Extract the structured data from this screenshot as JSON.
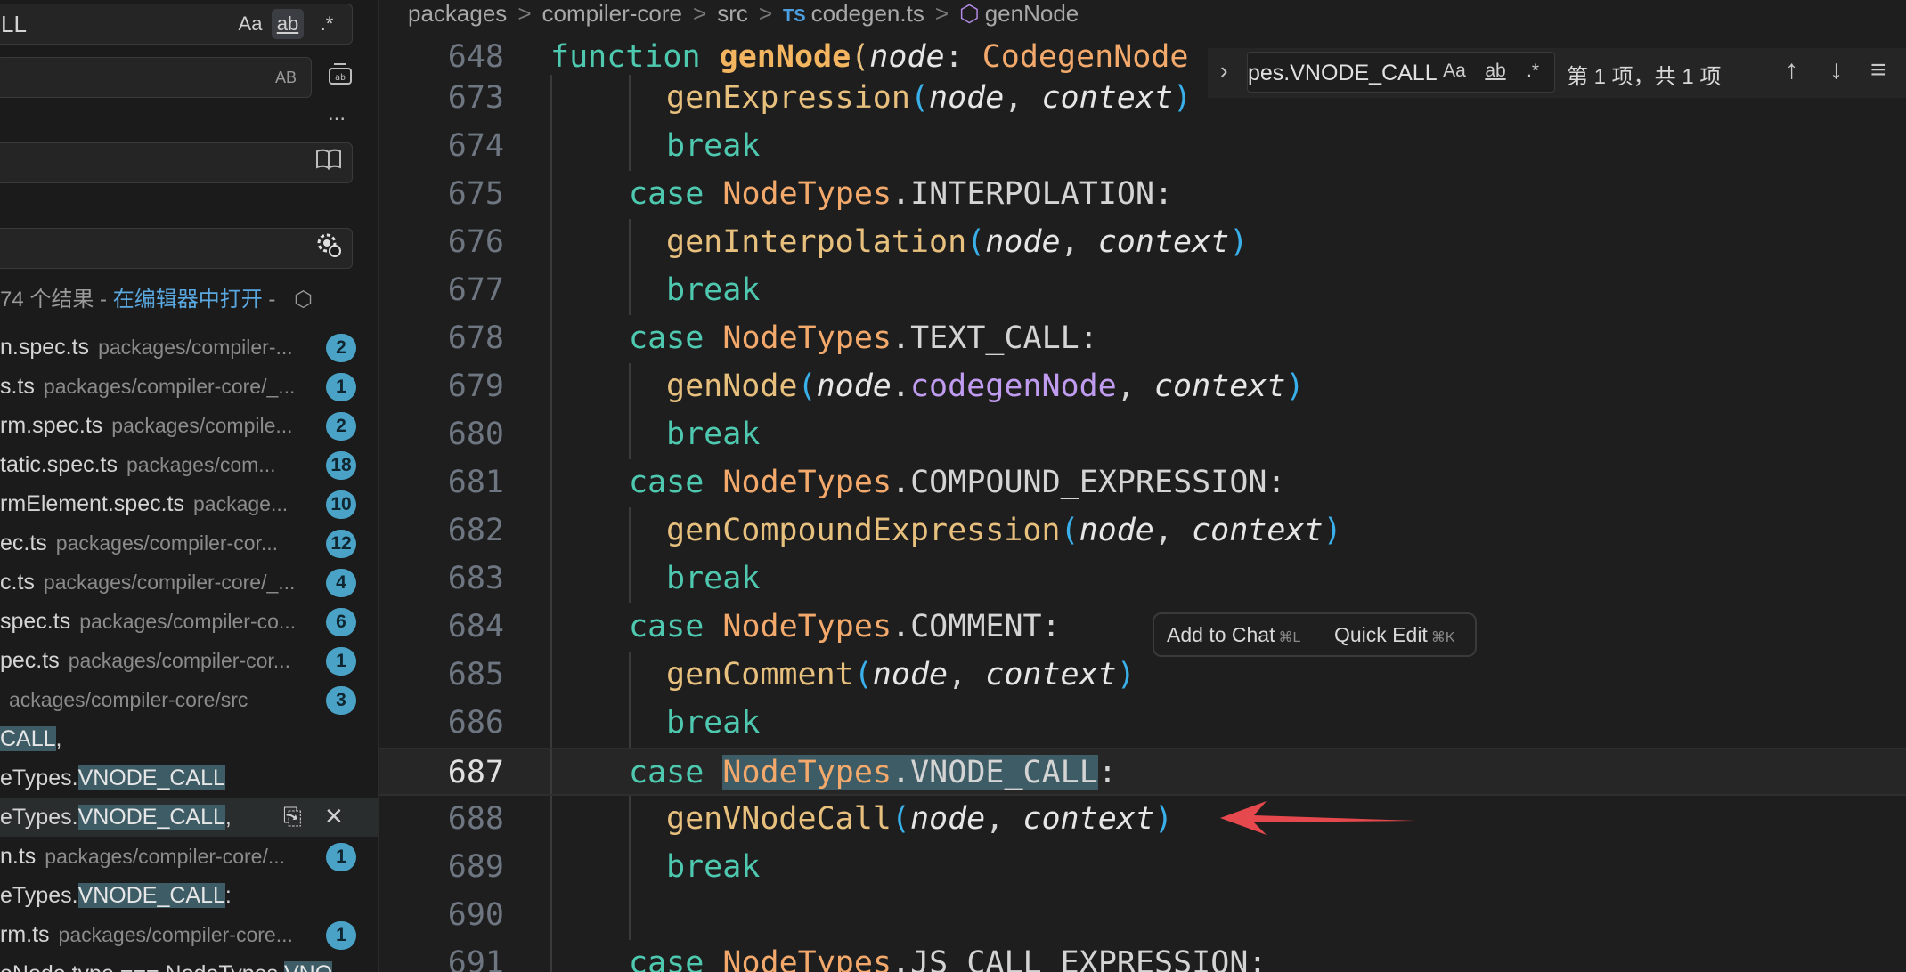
{
  "sidebar": {
    "search_value": "LL",
    "search_options": {
      "case": "Aa",
      "word": "ab",
      "regex": ".*"
    },
    "replace_preserve_case": "AB",
    "more_label": "...",
    "result_summary": {
      "count": "74 个结果 - ",
      "open_link": "在编辑器中打开",
      "suffix": " -"
    },
    "results": [
      {
        "file": "n.spec.ts",
        "path": "packages/compiler-...",
        "count": "2"
      },
      {
        "file": "s.ts",
        "path": "packages/compiler-core/_...",
        "count": "1"
      },
      {
        "file": "rm.spec.ts",
        "path": "packages/compile...",
        "count": "2"
      },
      {
        "file": "tatic.spec.ts",
        "path": "packages/com...",
        "count": "18"
      },
      {
        "file": "rmElement.spec.ts",
        "path": "package...",
        "count": "10"
      },
      {
        "file": "ec.ts",
        "path": "packages/compiler-cor...",
        "count": "12"
      },
      {
        "file": "c.ts",
        "path": "packages/compiler-core/_...",
        "count": "4"
      },
      {
        "file": "spec.ts",
        "path": "packages/compiler-co...",
        "count": "6"
      },
      {
        "file": "pec.ts",
        "path": "packages/compiler-cor...",
        "count": "1"
      },
      {
        "file": "",
        "path": "ackages/compiler-core/src",
        "count": "3"
      }
    ],
    "matches": [
      {
        "pre": "",
        "hl": "CALL",
        "post": ","
      },
      {
        "pre": "eTypes.",
        "hl": "VNODE_CALL",
        "post": ""
      },
      {
        "pre": "eTypes.",
        "hl": "VNODE_CALL",
        "post": ","
      }
    ],
    "results2": [
      {
        "file": "n.ts",
        "path": "packages/compiler-core/...",
        "count": "1"
      }
    ],
    "matches2": [
      {
        "pre": "eTypes.",
        "hl": "VNODE_CALL",
        "post": ":"
      }
    ],
    "results3": [
      {
        "file": "rm.ts",
        "path": "packages/compiler-core...",
        "count": "1"
      }
    ],
    "matches3": [
      {
        "pre": "eNode.type === NodeTypes.",
        "hl": "VNO",
        "post": ""
      }
    ]
  },
  "breadcrumb": {
    "items": [
      "packages",
      "compiler-core",
      "src"
    ],
    "file_badge": "TS",
    "file": "codegen.ts",
    "symbol": "genNode",
    "sep": ">"
  },
  "editor": {
    "sticky": {
      "ln": "648",
      "kw": "function",
      "fn": "genNode",
      "p1": "(",
      "param": "node",
      "colon": ": ",
      "type": "CodegenNode"
    },
    "lines": [
      {
        "ln": "673"
      },
      {
        "ln": "674"
      },
      {
        "ln": "675"
      },
      {
        "ln": "676"
      },
      {
        "ln": "677"
      },
      {
        "ln": "678"
      },
      {
        "ln": "679"
      },
      {
        "ln": "680"
      },
      {
        "ln": "681"
      },
      {
        "ln": "682"
      },
      {
        "ln": "683"
      },
      {
        "ln": "684"
      },
      {
        "ln": "685"
      },
      {
        "ln": "686"
      },
      {
        "ln": "687"
      },
      {
        "ln": "688"
      },
      {
        "ln": "689"
      },
      {
        "ln": "690"
      },
      {
        "ln": "691"
      }
    ],
    "tokens": {
      "break": "break",
      "case": "case",
      "NodeTypes": "NodeTypes",
      "dot": ".",
      "node": "node",
      "context": "context",
      "comma": ", ",
      "lp": "(",
      "rp": ")",
      "colon": ":",
      "genExpression": "genExpression",
      "INTERPOLATION": "INTERPOLATION",
      "genInterpolation": "genInterpolation",
      "TEXT_CALL": "TEXT_CALL",
      "genNode": "genNode",
      "codegenNode": "codegenNode",
      "COMPOUND_EXPRESSION": "COMPOUND_EXPRESSION",
      "genCompoundExpression": "genCompoundExpression",
      "COMMENT": "COMMENT",
      "genComment": "genComment",
      "VNODE_CALL": "VNODE_CALL",
      "genVNodeCall": "genVNodeCall",
      "JS_CALL_EXPRESSION": "JS_CALL_EXPRESSION"
    }
  },
  "find_widget": {
    "value": "pes.VNODE_CALL",
    "opt_case": "Aa",
    "opt_word": "ab",
    "opt_regex": ".*",
    "count": "第 1 项，共 1 项"
  },
  "hover_tip": {
    "add_to_chat": "Add to Chat",
    "add_kbd": "⌘L",
    "quick_edit": "Quick Edit",
    "quick_kbd": "⌘K"
  },
  "colors": {
    "arrow": "#e5484d",
    "badge": "#4aa3c6",
    "accent_link": "#5aa8e0"
  }
}
